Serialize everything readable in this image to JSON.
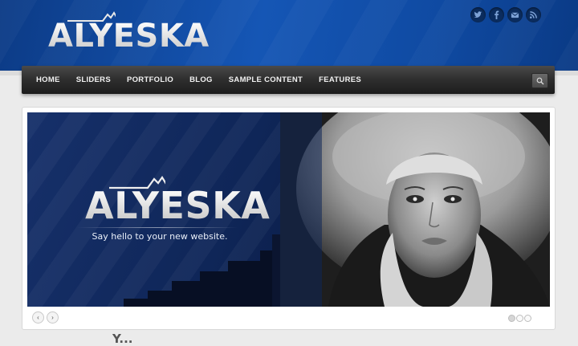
{
  "site": {
    "logo_text": "ALYESKA"
  },
  "social": [
    {
      "icon": "twitter-icon"
    },
    {
      "icon": "facebook-icon"
    },
    {
      "icon": "email-icon"
    },
    {
      "icon": "rss-icon"
    }
  ],
  "nav": {
    "items": [
      "Home",
      "Sliders",
      "Portfolio",
      "Blog",
      "Sample Content",
      "Features"
    ]
  },
  "slider": {
    "logo_text": "ALYESKA",
    "tagline": "Say hello to your new website.",
    "prev_label": "‹",
    "next_label": "›",
    "slide_count": 3,
    "active_slide": 1
  },
  "intro": {
    "text": "Y..."
  },
  "colors": {
    "header_blue": "#1556b5",
    "nav_dark": "#303030",
    "slide_navy": "#0f2658"
  }
}
